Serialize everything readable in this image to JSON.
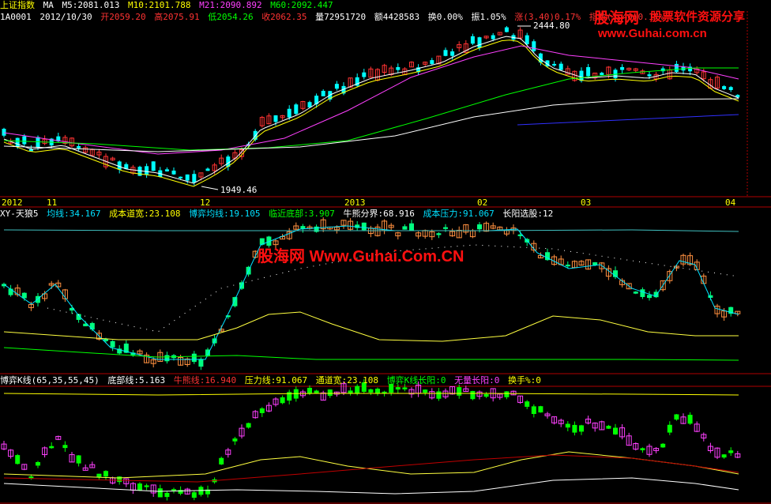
{
  "header1": {
    "index_name": "上证指数",
    "ma": "MA",
    "m5": "M5:2081.013",
    "m10": "M10:2101.788",
    "m21": "M21:2090.892",
    "m60": "M60:2092.447"
  },
  "header2": {
    "code": "1A0001",
    "date": "2012/10/30",
    "open": "开2059.20",
    "high": "高2075.91",
    "low": "低2054.26",
    "close": "收2062.35",
    "vol": "量72951720",
    "amt": "额4428583",
    "turnover": "换0.00%",
    "amp": "振1.05%",
    "chg": "涨(3.40)0.17%",
    "idx": "指数(3.40)0.17%"
  },
  "panel1": {
    "hi_label": "2444.80",
    "lo_label": "1949.46"
  },
  "dates": [
    "2012",
    "11",
    "12",
    "2013",
    "02",
    "03",
    "04"
  ],
  "panel2_header": {
    "name": "XY-天狼5",
    "avg": "均线:34.167",
    "cost_width": "成本道宽:23.108",
    "game_avg": "博弈均线:19.105",
    "near_bottom": "临近底部:3.907",
    "bull_div": "牛熊分界:68.916",
    "cost_press": "成本压力:91.067",
    "long_yang": "长阳选股:12"
  },
  "panel3_header": {
    "name": "博弈K线(65,35,55,45)",
    "bottom": "底部线:5.163",
    "bull": "牛熊线:16.940",
    "press": "压力线:91.067",
    "channel": "通道宽:23.108",
    "game_yang": "博弈K线长阳:0",
    "no_yang": "无量长阳:0",
    "turn": "换手%:0"
  },
  "watermark": {
    "logo": "股海网",
    "slogan": "股票软件资源分享",
    "url": "www.Guhai.com.cn",
    "center": "股海网 Www.Guhai.Com.CN"
  },
  "colors": {
    "up": "#ff3333",
    "down": "#00ffff",
    "panel_up": "#ff66ff",
    "panel_down": "#00ff00",
    "axis": "#b00000"
  }
}
